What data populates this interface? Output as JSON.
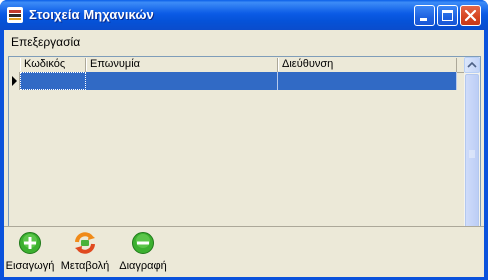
{
  "window": {
    "title": "Στοιχεία Μηχανικών"
  },
  "menu": {
    "items": [
      "Επεξεργασία"
    ]
  },
  "grid": {
    "columns": [
      "Κωδικός",
      "Επωνυμία",
      "Διεύθυνση"
    ],
    "rows": [
      [
        "",
        "",
        ""
      ]
    ],
    "selected_row": 0
  },
  "toolbar": {
    "insert_label": "Εισαγωγή",
    "edit_label": "Μεταβολή",
    "delete_label": "Διαγραφή"
  },
  "colors": {
    "titlebar": "#0a52dc",
    "selection": "#316ac5",
    "insert_icon": "#3cb030",
    "edit_icon": "#f08a18",
    "delete_icon": "#3cb030"
  },
  "icons": [
    "app-icon",
    "minimize-icon",
    "maximize-icon",
    "close-icon",
    "add-icon",
    "refresh-edit-icon",
    "remove-icon"
  ]
}
